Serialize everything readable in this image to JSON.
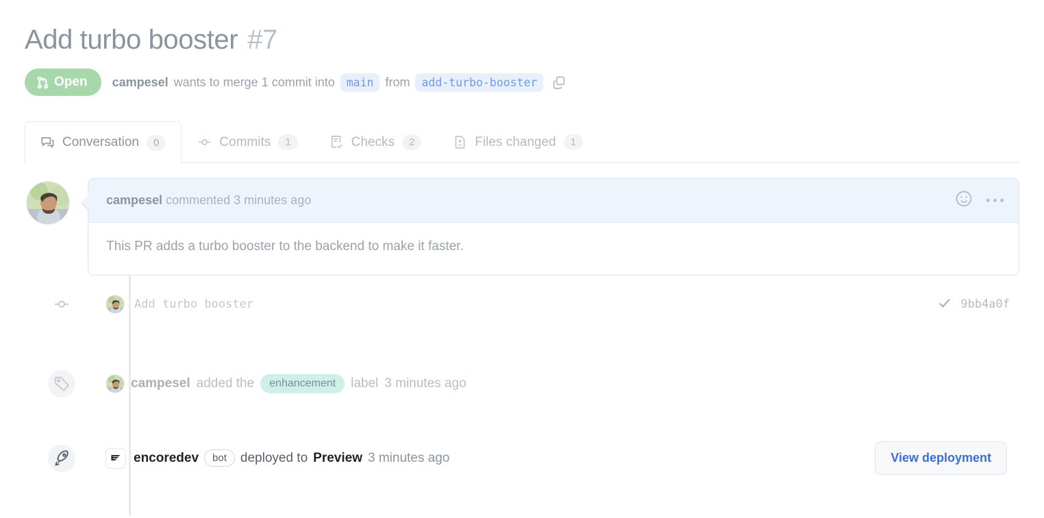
{
  "header": {
    "title": "Add turbo booster",
    "number": "#7",
    "state": "Open",
    "state_icon": "git-pull-request-icon",
    "author": "campesel",
    "merge_text_1": "wants to merge 1 commit into",
    "base_branch": "main",
    "merge_text_2": "from",
    "head_branch": "add-turbo-booster",
    "copy_icon": "copy-icon"
  },
  "tabs": [
    {
      "label": "Conversation",
      "count": "0",
      "icon": "comment-discussion-icon",
      "active": true
    },
    {
      "label": "Commits",
      "count": "1",
      "icon": "git-commit-icon",
      "active": false
    },
    {
      "label": "Checks",
      "count": "2",
      "icon": "checklist-icon",
      "active": false
    },
    {
      "label": "Files changed",
      "count": "1",
      "icon": "file-diff-icon",
      "active": false
    }
  ],
  "comment": {
    "author": "campesel",
    "action": "commented",
    "timestamp": "3 minutes ago",
    "body": "This PR adds a turbo booster to the backend to make it faster.",
    "reaction_icon": "smiley-icon",
    "menu_icon": "kebab-horizontal-icon"
  },
  "timeline": {
    "commit": {
      "icon": "git-commit-icon",
      "message": "Add turbo booster",
      "status_icon": "check-icon",
      "sha": "9bb4a0f"
    },
    "label_event": {
      "icon": "tag-icon",
      "actor": "campesel",
      "action": "added the",
      "label": "enhancement",
      "suffix": "label",
      "timestamp": "3 minutes ago"
    },
    "deployment": {
      "icon": "rocket-icon",
      "actor": "encoredev",
      "actor_icon": "encore-logo-icon",
      "badge": "bot",
      "action": "deployed to",
      "environment": "Preview",
      "timestamp": "3 minutes ago",
      "button_label": "View deployment"
    }
  },
  "colors": {
    "open_badge": "#a7d8ab",
    "branch_text": "#6b9bf0",
    "branch_bg": "#e8f0fe",
    "label_chip": "#cdf0ea",
    "link_blue": "#3b6ddb",
    "check_green": "#8fc79a"
  }
}
